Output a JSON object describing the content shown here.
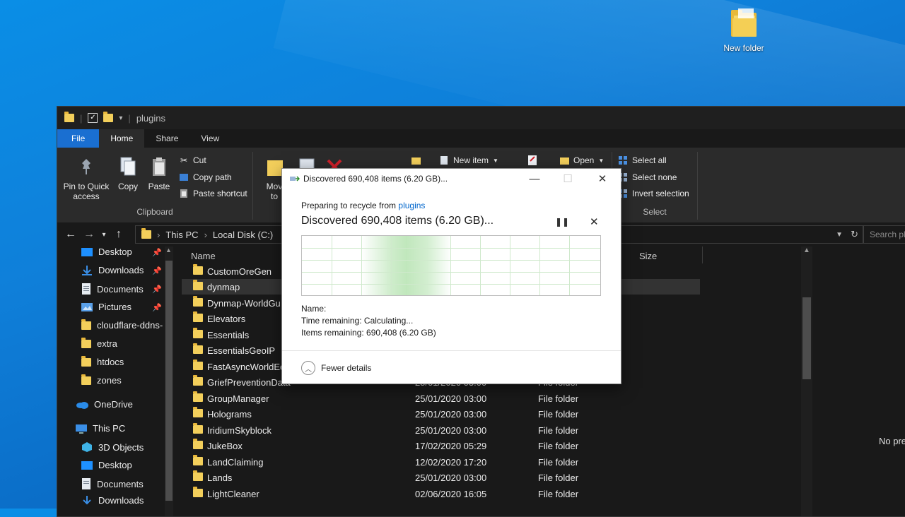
{
  "desktop": {
    "icon_label": "New folder"
  },
  "explorer": {
    "title": "plugins",
    "tabs": [
      "File",
      "Home",
      "Share",
      "View"
    ],
    "ribbon": {
      "pin_label_1": "Pin to Quick",
      "pin_label_2": "access",
      "copy_label": "Copy",
      "paste_label": "Paste",
      "cut_label": "Cut",
      "copy_path_label": "Copy path",
      "paste_shortcut_label": "Paste shortcut",
      "clipboard_group": "Clipboard",
      "move_label_1": "Mov",
      "move_label_2": "to",
      "new_item_label": "New item",
      "open_label": "Open",
      "select_all_label": "Select all",
      "select_none_label": "Select none",
      "invert_selection_label": "Invert selection",
      "select_group": "Select"
    },
    "address": {
      "crumbs": [
        "This PC",
        "Local Disk (C:)"
      ],
      "search_placeholder": "Search pl"
    },
    "nav": {
      "quick_access": [
        "Desktop",
        "Downloads",
        "Documents",
        "Pictures",
        "cloudflare-ddns-",
        "extra",
        "htdocs",
        "zones"
      ],
      "onedrive": "OneDrive",
      "this_pc": "This PC",
      "this_pc_items": [
        "3D Objects",
        "Desktop",
        "Documents",
        "Downloads"
      ]
    },
    "columns": {
      "name": "Name",
      "size": "Size"
    },
    "files": [
      {
        "name": "CustomOreGen",
        "date": "",
        "type": ""
      },
      {
        "name": "dynmap",
        "date": "",
        "type": ""
      },
      {
        "name": "Dynmap-WorldGu",
        "date": "",
        "type": ""
      },
      {
        "name": "Elevators",
        "date": "",
        "type": ""
      },
      {
        "name": "Essentials",
        "date": "",
        "type": ""
      },
      {
        "name": "EssentialsGeoIP",
        "date": "",
        "type": ""
      },
      {
        "name": "FastAsyncWorldEd",
        "date": "",
        "type": ""
      },
      {
        "name": "GriefPreventionData",
        "date": "25/01/2020 03:00",
        "type": "File folder"
      },
      {
        "name": "GroupManager",
        "date": "25/01/2020 03:00",
        "type": "File folder"
      },
      {
        "name": "Holograms",
        "date": "25/01/2020 03:00",
        "type": "File folder"
      },
      {
        "name": "IridiumSkyblock",
        "date": "25/01/2020 03:00",
        "type": "File folder"
      },
      {
        "name": "JukeBox",
        "date": "17/02/2020 05:29",
        "type": "File folder"
      },
      {
        "name": "LandClaiming",
        "date": "12/02/2020 17:20",
        "type": "File folder"
      },
      {
        "name": "Lands",
        "date": "25/01/2020 03:00",
        "type": "File folder"
      },
      {
        "name": "LightCleaner",
        "date": "02/06/2020 16:05",
        "type": "File folder"
      }
    ],
    "preview_text": "No pre"
  },
  "dialog": {
    "title": "Discovered 690,408 items (6.20 GB)...",
    "preparing_prefix": "Preparing to recycle from ",
    "preparing_link": "plugins",
    "headline": "Discovered 690,408 items (6.20 GB)...",
    "name_label": "Name:",
    "time_remaining": "Time remaining:  Calculating...",
    "items_remaining": "Items remaining:  690,408 (6.20 GB)",
    "fewer_details": "Fewer details"
  }
}
